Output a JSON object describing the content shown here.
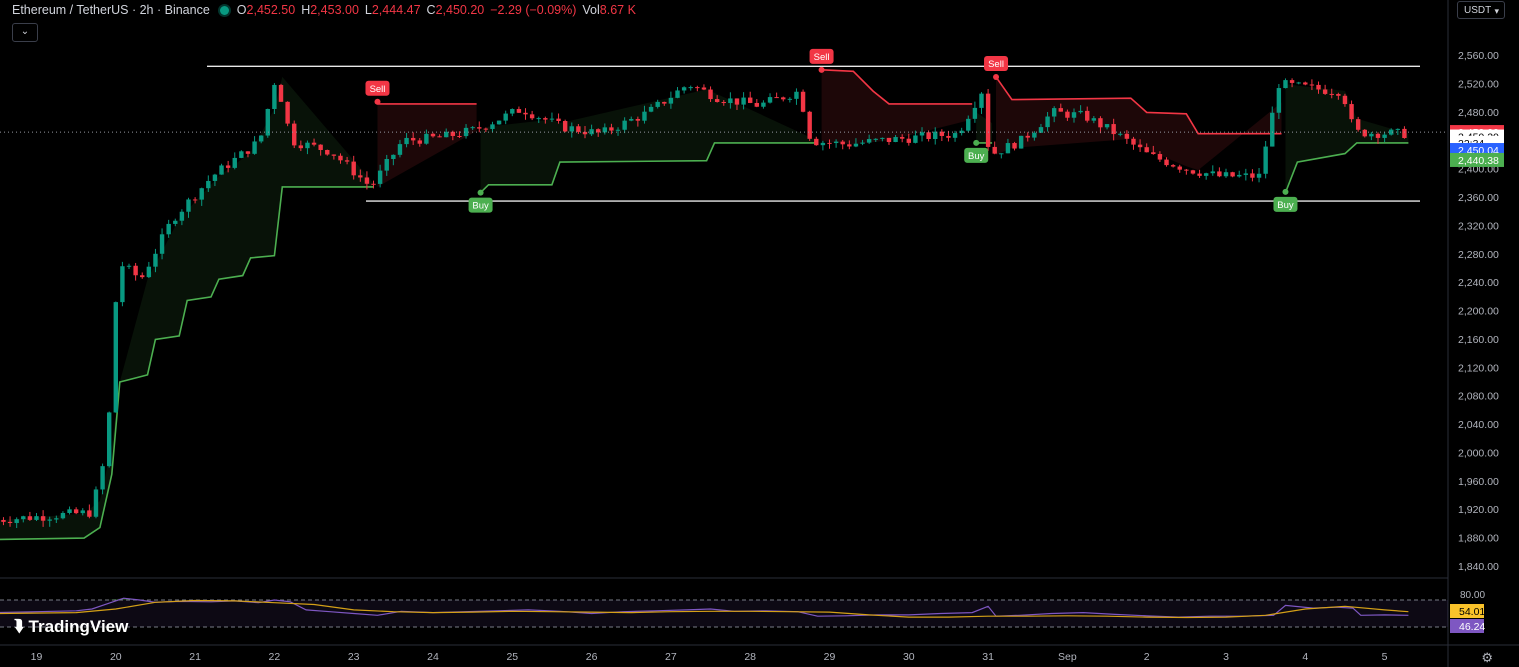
{
  "header": {
    "symbol": "Ethereum / TetherUS · 2h · Binance",
    "o_label": "O",
    "o_value": "2,452.50",
    "h_label": "H",
    "h_value": "2,453.00",
    "l_label": "L",
    "l_value": "2,444.47",
    "c_label": "C",
    "c_value": "2,450.20",
    "change": "−2.29 (−0.09%)",
    "vol_label": "Vol",
    "vol_value": "8.67 K"
  },
  "currency": "USDT",
  "brand": "TradingView",
  "colors": {
    "up": "#089981",
    "down": "#f23645",
    "supertrend_up": "#4caf50",
    "supertrend_down": "#f23645",
    "rsi": "#7e57c2",
    "rsi_ma": "#d4a017",
    "background": "#000000"
  },
  "price_labels": [
    {
      "text": "2,452.32",
      "bg": "#f23645",
      "fg": "#ffffff",
      "value": 2452.32
    },
    {
      "text": "2,450.20",
      "bg": "#ffffff",
      "fg": "#000000",
      "value": 2446
    },
    {
      "text": "22:34",
      "bg": "#ffffff",
      "fg": "#000000",
      "value": 2437
    },
    {
      "text": "2,450.04",
      "bg": "#2962ff",
      "fg": "#ffffff",
      "value": 2427
    },
    {
      "text": "2,440.38",
      "bg": "#4caf50",
      "fg": "#ffffff",
      "value": 2413
    }
  ],
  "rsi_labels": [
    {
      "text": "54.01",
      "bg": "#f9c22a",
      "fg": "#000000",
      "value": 54.01
    },
    {
      "text": "46.24",
      "bg": "#7e57c2",
      "fg": "#ffffff",
      "value": 46.24
    }
  ],
  "chart_data": {
    "type": "candlestick",
    "title": "Ethereum / TetherUS · 2h · Binance",
    "x_tick_labels": [
      "19",
      "20",
      "21",
      "22",
      "23",
      "24",
      "25",
      "26",
      "27",
      "28",
      "29",
      "30",
      "31",
      "Sep",
      "2",
      "3",
      "4",
      "5"
    ],
    "y_tick_labels": [
      "2,560.00",
      "2,520.00",
      "2,480.00",
      "2,440.00",
      "2,400.00",
      "2,360.00",
      "2,320.00",
      "2,280.00",
      "2,240.00",
      "2,200.00",
      "2,160.00",
      "2,120.00",
      "2,080.00",
      "2,040.00",
      "2,000.00",
      "1,960.00",
      "1,920.00",
      "1,880.00",
      "1,840.00"
    ],
    "ylim": [
      1825,
      2600
    ],
    "horizontal_lines": [
      2545,
      2355
    ],
    "last_price": 2450.2,
    "signals": [
      {
        "label": "Sell",
        "type": "sell",
        "day": 23.3,
        "price": 2495
      },
      {
        "label": "Buy",
        "type": "buy",
        "day": 24.6,
        "price": 2367
      },
      {
        "label": "Sell",
        "type": "sell",
        "day": 28.9,
        "price": 2540
      },
      {
        "label": "Buy",
        "type": "buy",
        "day": 30.85,
        "price": 2437
      },
      {
        "label": "Sell",
        "type": "sell",
        "day": 31.1,
        "price": 2530
      },
      {
        "label": "Buy",
        "type": "buy",
        "day": 34.75,
        "price": 2368
      }
    ],
    "price_path": [
      [
        18.5,
        1905
      ],
      [
        19.3,
        1912
      ],
      [
        19.75,
        1916
      ],
      [
        19.9,
        1965
      ],
      [
        20.05,
        2100
      ],
      [
        20.1,
        2270
      ],
      [
        20.4,
        2245
      ],
      [
        20.8,
        2330
      ],
      [
        21.3,
        2390
      ],
      [
        21.9,
        2440
      ],
      [
        22.1,
        2530
      ],
      [
        22.3,
        2440
      ],
      [
        22.8,
        2425
      ],
      [
        23.3,
        2375
      ],
      [
        23.7,
        2440
      ],
      [
        24.2,
        2445
      ],
      [
        24.6,
        2455
      ],
      [
        25.2,
        2485
      ],
      [
        25.7,
        2460
      ],
      [
        26.2,
        2450
      ],
      [
        26.8,
        2480
      ],
      [
        27.3,
        2520
      ],
      [
        27.7,
        2500
      ],
      [
        28.2,
        2490
      ],
      [
        28.7,
        2510
      ],
      [
        28.85,
        2440
      ],
      [
        29.3,
        2435
      ],
      [
        29.7,
        2440
      ],
      [
        30.2,
        2445
      ],
      [
        30.7,
        2450
      ],
      [
        31.0,
        2510
      ],
      [
        31.1,
        2420
      ],
      [
        31.5,
        2440
      ],
      [
        31.9,
        2480
      ],
      [
        32.3,
        2475
      ],
      [
        32.7,
        2450
      ],
      [
        33.1,
        2420
      ],
      [
        33.6,
        2400
      ],
      [
        34.0,
        2390
      ],
      [
        34.5,
        2390
      ],
      [
        34.75,
        2520
      ],
      [
        35.3,
        2512
      ],
      [
        35.55,
        2510
      ],
      [
        35.7,
        2452
      ],
      [
        36.3,
        2450
      ]
    ],
    "supertrend": [
      {
        "trend": "up",
        "points": [
          [
            18.5,
            1878
          ],
          [
            19.6,
            1880
          ],
          [
            19.8,
            1895
          ],
          [
            19.95,
            1970
          ],
          [
            20.05,
            2100
          ],
          [
            20.4,
            2110
          ],
          [
            20.5,
            2160
          ],
          [
            20.8,
            2165
          ],
          [
            20.9,
            2215
          ],
          [
            21.2,
            2220
          ],
          [
            21.3,
            2245
          ],
          [
            21.6,
            2250
          ],
          [
            21.7,
            2275
          ],
          [
            22.0,
            2278
          ],
          [
            22.1,
            2375
          ],
          [
            23.25,
            2375
          ]
        ]
      },
      {
        "trend": "down",
        "points": [
          [
            23.3,
            2492
          ],
          [
            24.55,
            2492
          ]
        ]
      },
      {
        "trend": "up",
        "points": [
          [
            24.6,
            2367
          ],
          [
            24.7,
            2378
          ],
          [
            25.5,
            2378
          ],
          [
            25.6,
            2410
          ],
          [
            27.45,
            2412
          ],
          [
            27.55,
            2437
          ],
          [
            28.85,
            2437
          ]
        ]
      },
      {
        "trend": "down",
        "points": [
          [
            28.9,
            2540
          ],
          [
            29.3,
            2538
          ],
          [
            29.55,
            2510
          ],
          [
            29.75,
            2492
          ],
          [
            30.8,
            2492
          ]
        ]
      },
      {
        "trend": "up",
        "points": [
          [
            30.85,
            2437
          ],
          [
            31.05,
            2437
          ]
        ]
      },
      {
        "trend": "down",
        "points": [
          [
            31.1,
            2530
          ],
          [
            31.3,
            2498
          ],
          [
            32.8,
            2500
          ],
          [
            33.0,
            2480
          ],
          [
            33.5,
            2478
          ],
          [
            33.65,
            2450
          ],
          [
            34.7,
            2450
          ]
        ]
      },
      {
        "trend": "up",
        "points": [
          [
            34.75,
            2367
          ],
          [
            34.9,
            2410
          ],
          [
            35.5,
            2422
          ],
          [
            35.65,
            2437
          ],
          [
            36.3,
            2437
          ]
        ]
      }
    ],
    "rsi": {
      "ylim": [
        30,
        90
      ],
      "upper_band": 80,
      "lower_band": 20,
      "rsi_value": 46.24,
      "ma_value": 54.01,
      "ma_path": [
        [
          18.5,
          50
        ],
        [
          19.5,
          52
        ],
        [
          20.0,
          60
        ],
        [
          20.5,
          75
        ],
        [
          21.0,
          79
        ],
        [
          21.5,
          78
        ],
        [
          22.0,
          74
        ],
        [
          22.5,
          70
        ],
        [
          23.0,
          58
        ],
        [
          23.5,
          54
        ],
        [
          24.0,
          52
        ],
        [
          24.5,
          53
        ],
        [
          25.0,
          55
        ],
        [
          25.5,
          54
        ],
        [
          26.0,
          53
        ],
        [
          26.5,
          52
        ],
        [
          27.0,
          54
        ],
        [
          27.5,
          55
        ],
        [
          28.0,
          55
        ],
        [
          28.5,
          54
        ],
        [
          29.0,
          53
        ],
        [
          29.5,
          47
        ],
        [
          30.0,
          42
        ],
        [
          30.5,
          42
        ],
        [
          31.0,
          44
        ],
        [
          31.5,
          44
        ],
        [
          32.0,
          45
        ],
        [
          32.5,
          44
        ],
        [
          33.0,
          42
        ],
        [
          33.5,
          41
        ],
        [
          34.0,
          42
        ],
        [
          34.5,
          46
        ],
        [
          35.0,
          60
        ],
        [
          35.5,
          66
        ],
        [
          36.0,
          58
        ],
        [
          36.3,
          54
        ]
      ],
      "rsi_path": [
        [
          18.5,
          52
        ],
        [
          19.0,
          54
        ],
        [
          19.5,
          56
        ],
        [
          19.7,
          60
        ],
        [
          19.9,
          72
        ],
        [
          20.1,
          84
        ],
        [
          20.3,
          80
        ],
        [
          20.5,
          75
        ],
        [
          20.8,
          77
        ],
        [
          21.2,
          76
        ],
        [
          21.5,
          78
        ],
        [
          21.8,
          74
        ],
        [
          22.0,
          80
        ],
        [
          22.2,
          76
        ],
        [
          22.4,
          58
        ],
        [
          22.7,
          54
        ],
        [
          23.0,
          50
        ],
        [
          23.3,
          46
        ],
        [
          23.6,
          55
        ],
        [
          24.0,
          52
        ],
        [
          24.4,
          54
        ],
        [
          24.8,
          56
        ],
        [
          25.2,
          58
        ],
        [
          25.6,
          55
        ],
        [
          26.0,
          50
        ],
        [
          26.4,
          54
        ],
        [
          26.8,
          56
        ],
        [
          27.2,
          58
        ],
        [
          27.5,
          60
        ],
        [
          27.8,
          55
        ],
        [
          28.2,
          56
        ],
        [
          28.6,
          54
        ],
        [
          28.85,
          44
        ],
        [
          29.2,
          45
        ],
        [
          29.6,
          47
        ],
        [
          30.0,
          47
        ],
        [
          30.4,
          50
        ],
        [
          30.8,
          52
        ],
        [
          31.0,
          66
        ],
        [
          31.1,
          44
        ],
        [
          31.4,
          46
        ],
        [
          31.8,
          50
        ],
        [
          32.2,
          52
        ],
        [
          32.6,
          48
        ],
        [
          33.0,
          45
        ],
        [
          33.4,
          42
        ],
        [
          33.8,
          44
        ],
        [
          34.2,
          44
        ],
        [
          34.6,
          46
        ],
        [
          34.75,
          68
        ],
        [
          35.1,
          62
        ],
        [
          35.4,
          64
        ],
        [
          35.6,
          62
        ],
        [
          35.7,
          46
        ],
        [
          36.0,
          47
        ],
        [
          36.3,
          46
        ]
      ]
    },
    "grid": false
  }
}
